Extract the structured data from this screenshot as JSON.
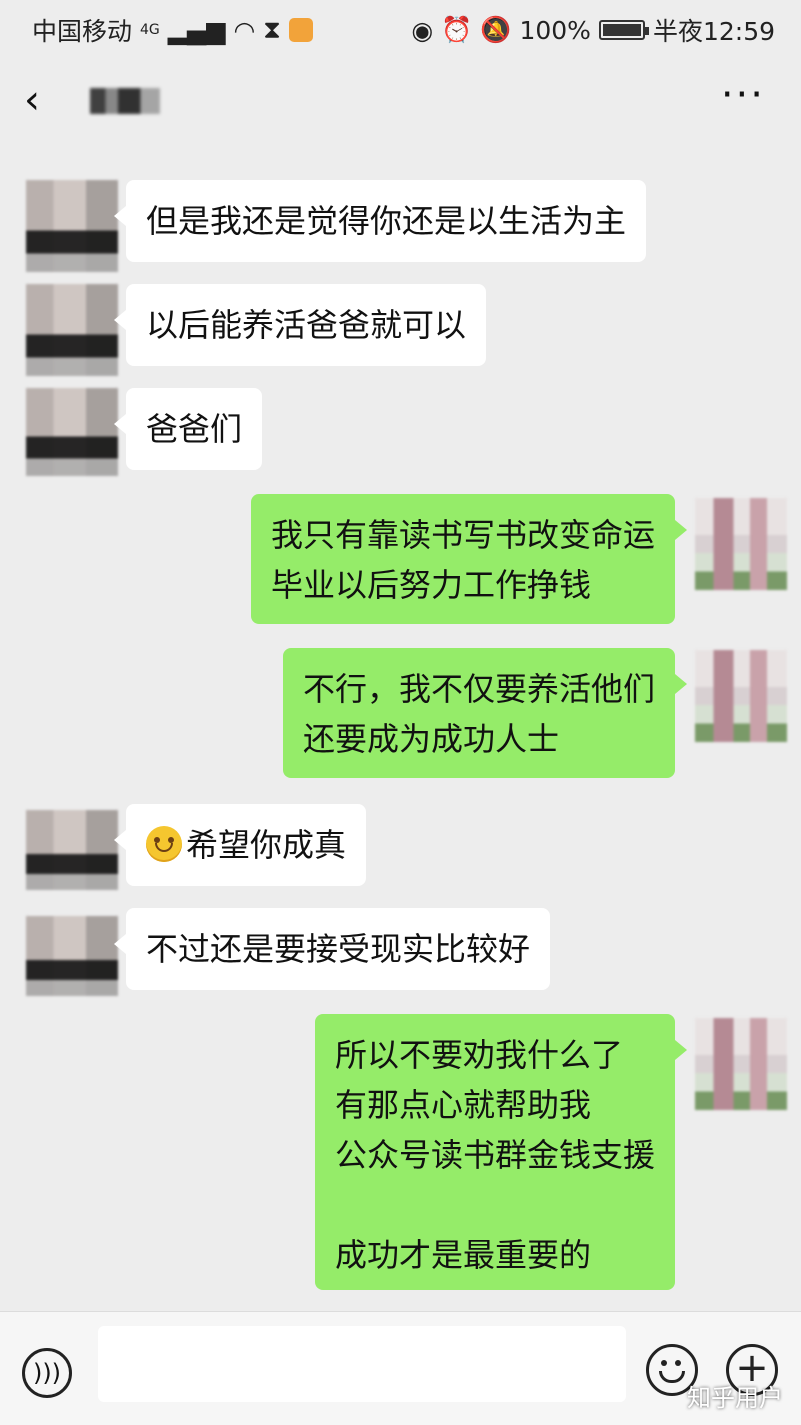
{
  "status_bar": {
    "carrier": "中国移动",
    "network": "4G",
    "battery": "100%",
    "time": "半夜12:59"
  },
  "nav": {
    "back_icon": "chevron-left-icon",
    "more_icon": "more-icon"
  },
  "messages": [
    {
      "side": "in",
      "lines": [
        "但是我还是觉得你还是以生活为主"
      ]
    },
    {
      "side": "in",
      "lines": [
        "以后能养活爸爸就可以"
      ]
    },
    {
      "side": "in",
      "lines": [
        "爸爸们"
      ]
    },
    {
      "side": "out",
      "lines": [
        "我只有靠读书写书改变命运",
        "毕业以后努力工作挣钱"
      ]
    },
    {
      "side": "out",
      "lines": [
        "不行，我不仅要养活他们",
        "还要成为成功人士"
      ]
    },
    {
      "side": "in",
      "emoji": "smile",
      "lines": [
        "希望你成真"
      ]
    },
    {
      "side": "in",
      "lines": [
        "不过还是要接受现实比较好"
      ]
    },
    {
      "side": "out",
      "lines": [
        "所以不要劝我什么了",
        "有那点心就帮助我",
        "公众号读书群金钱支援",
        "",
        "成功才是最重要的"
      ]
    }
  ],
  "input_bar": {
    "voice_icon": "voice-icon",
    "emoji_icon": "emoji-icon",
    "plus_icon": "plus-icon"
  },
  "watermark": "知乎用户",
  "colors": {
    "background": "#ededed",
    "incoming_bubble": "#ffffff",
    "outgoing_bubble": "#95ec69"
  }
}
